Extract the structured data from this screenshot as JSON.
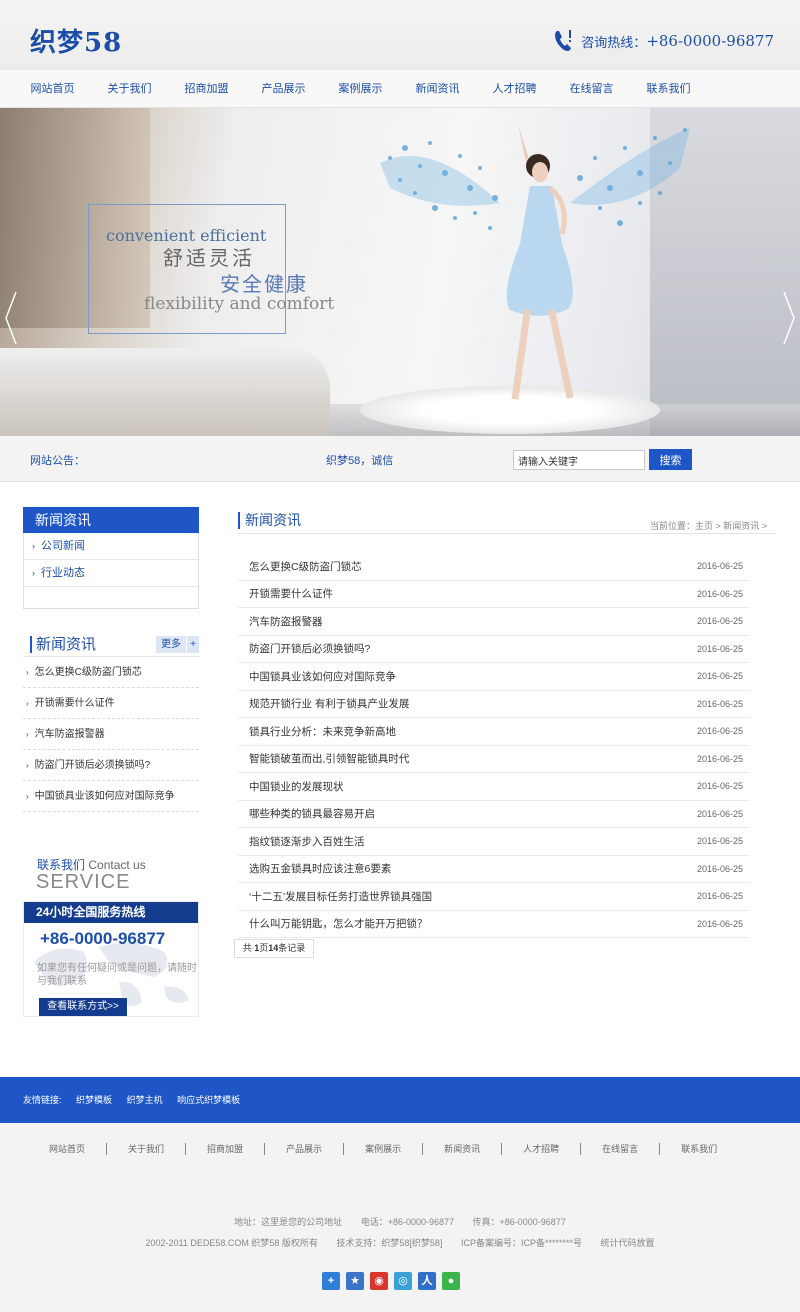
{
  "header": {
    "logo": "织梦58",
    "hotline_label": "咨询热线：",
    "hotline_number": "+86-0000-96877"
  },
  "nav": {
    "items": [
      "网站首页",
      "关于我们",
      "招商加盟",
      "产品展示",
      "案例展示",
      "新闻资讯",
      "人才招聘",
      "在线留言",
      "联系我们"
    ]
  },
  "banner": {
    "slogan_en1": "convenient efficient",
    "slogan_cn1": "舒适灵活",
    "slogan_cn2": "安全健康",
    "slogan_en2": "flexibility and comfort"
  },
  "notice": {
    "label": "网站公告：",
    "text": "织梦58，诚信",
    "search_value": "请输入关键字",
    "search_button": "搜索"
  },
  "sidebar": {
    "category_title": "新闻资讯",
    "categories": [
      "公司新闻",
      "行业动态"
    ],
    "news_title": "新闻资讯",
    "more_label": "更多",
    "plus_label": "+",
    "news": [
      "怎么更换C级防盗门锁芯",
      "开锁需要什么证件",
      "汽车防盗报警器",
      "防盗门开锁后必须换锁吗?",
      "中国锁具业该如何应对国际竞争"
    ],
    "contact_cn": "联系我们",
    "contact_en": "Contact us",
    "service": "SERVICE",
    "hotline_title": "24小时全国服务热线",
    "hotline": "+86-0000-96877",
    "contact_desc": "如果您有任何疑问或是问题，请随时与我们联系",
    "contact_button": "查看联系方式>>"
  },
  "main": {
    "title": "新闻资讯",
    "breadcrumb": "当前位置：主页 > 新闻资讯 >",
    "articles": [
      {
        "title": "怎么更换C级防盗门锁芯",
        "date": "2016-06-25"
      },
      {
        "title": "开锁需要什么证件",
        "date": "2016-06-25"
      },
      {
        "title": "汽车防盗报警器",
        "date": "2016-06-25"
      },
      {
        "title": "防盗门开锁后必须换锁吗?",
        "date": "2016-06-25"
      },
      {
        "title": "中国锁具业该如何应对国际竞争",
        "date": "2016-06-25"
      },
      {
        "title": "规范开锁行业 有利于锁具产业发展",
        "date": "2016-06-25"
      },
      {
        "title": "锁具行业分析：未来竞争新高地",
        "date": "2016-06-25"
      },
      {
        "title": "智能锁破茧而出,引领智能锁具时代",
        "date": "2016-06-25"
      },
      {
        "title": "中国锁业的发展现状",
        "date": "2016-06-25"
      },
      {
        "title": "哪些种类的锁具最容易开启",
        "date": "2016-06-25"
      },
      {
        "title": "指纹锁逐渐步入百姓生活",
        "date": "2016-06-25"
      },
      {
        "title": "选购五金锁具时应该注意6要素",
        "date": "2016-06-25"
      },
      {
        "title": "‘十二五’发展目标任务打造世界锁具强国",
        "date": "2016-06-25"
      },
      {
        "title": "什么叫万能钥匙，怎么才能开万把锁？",
        "date": "2016-06-25"
      }
    ],
    "pager_prefix": "共 ",
    "pager_pages": "1",
    "pager_mid": "页",
    "pager_count": "14",
    "pager_suffix": "条记录"
  },
  "footer": {
    "links_label": "友情链接:",
    "links": [
      "织梦模板",
      "织梦主机",
      "响应式织梦模板"
    ],
    "nav": [
      "网站首页",
      "关于我们",
      "招商加盟",
      "产品展示",
      "案例展示",
      "新闻资讯",
      "人才招聘",
      "在线留言",
      "联系我们"
    ],
    "address": "地址：这里是您的公司地址",
    "phone": "电话：+86-0000-96877",
    "fax": "传真：+86-0000-96877",
    "copyright": "2002-2011 DEDE58.COM 织梦58 版权所有",
    "tech": "技术支持：织梦58[织梦58]",
    "icp": "ICP备案编号：ICP备********号",
    "stats": "统计代码放置",
    "share_colors": [
      "#2f7fd8",
      "#3a74c9",
      "#d9352b",
      "#3aa1d8",
      "#2f6fc9",
      "#3bb54a"
    ]
  }
}
